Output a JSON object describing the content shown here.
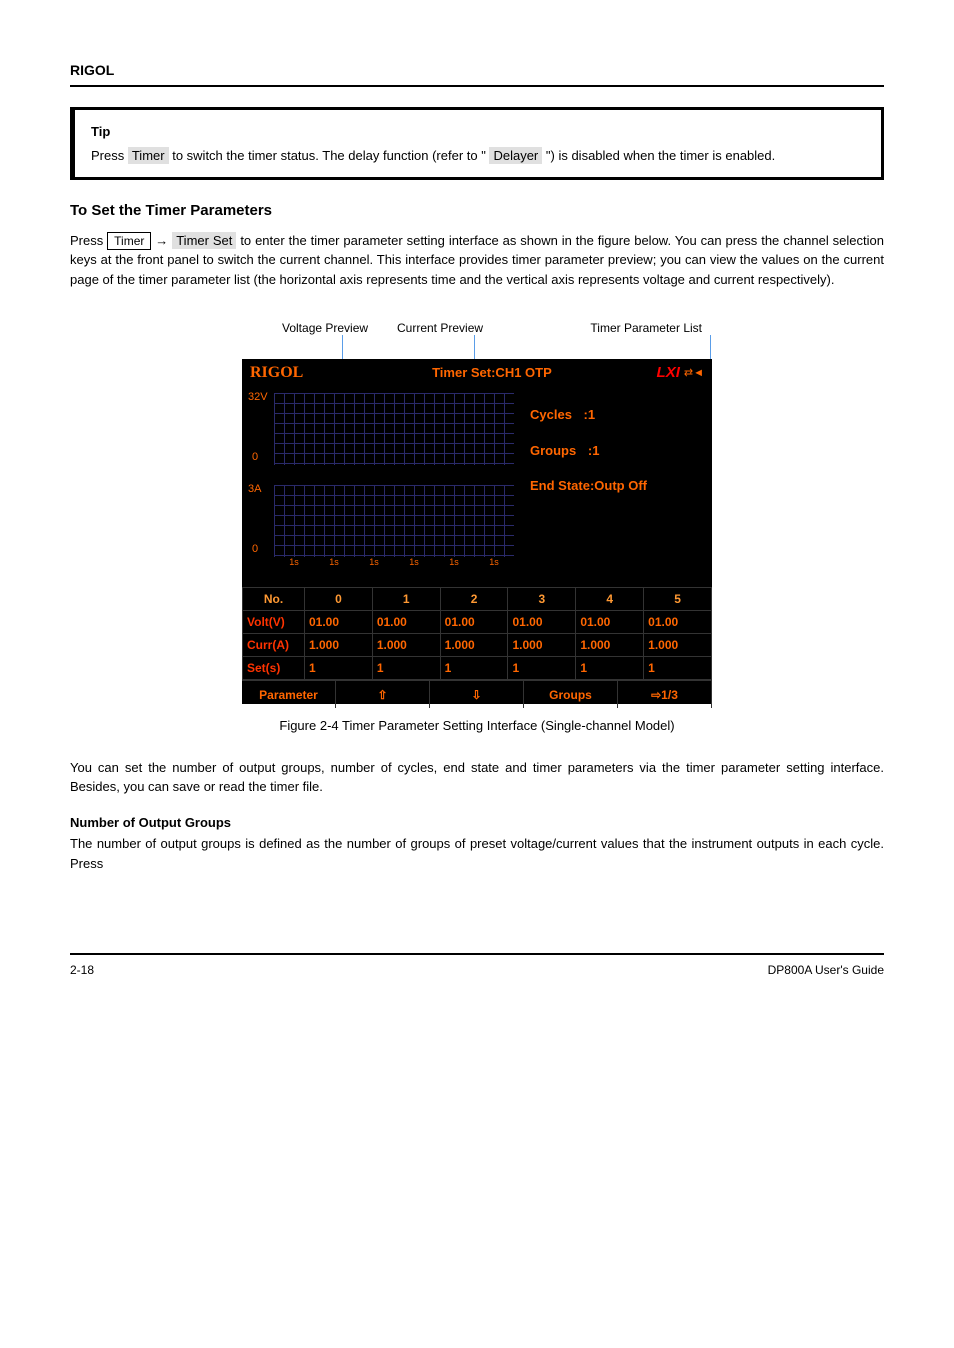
{
  "header": {
    "brand": "RIGOL"
  },
  "tip": {
    "title": "Tip",
    "text_before": "Press ",
    "btn1": "Timer",
    "text_mid": " to switch the timer status. The delay function (refer to \"",
    "btn2": "Delayer",
    "text_after": "\") is disabled when the timer is enabled."
  },
  "section": {
    "heading": "To Set the Timer Parameters",
    "para1_before": "Press ",
    "para1_btn1": "Timer",
    "para1_arrow": " → ",
    "para1_btn2": "Timer Set",
    "para1_after": " to enter the timer parameter setting interface as shown in the figure below. You can press the channel selection keys at the front panel to switch the current channel. This interface provides timer parameter preview; you can view the values on the current page of the timer parameter list (the horizontal axis represents time and the vertical axis represents voltage and current respectively).",
    "labels": {
      "volt": "Voltage Preview",
      "curr": "Current Preview",
      "list": "Timer Parameter List"
    }
  },
  "screen": {
    "logo": "RIGOL",
    "title": "Timer Set:CH1  OTP",
    "lxi": "LXI",
    "preview_volt_top": "32V",
    "preview_volt_bottom": "0",
    "preview_curr_top": "3A",
    "preview_curr_bottom": "0",
    "xticks": [
      "1s",
      "1s",
      "1s",
      "1s",
      "1s",
      "1s"
    ],
    "side": {
      "cycles_label": "Cycles",
      "cycles_val": ":1",
      "groups_label": "Groups",
      "groups_val": ":1",
      "endstate": "End State:Outp Off"
    },
    "table": {
      "headers": [
        "No.",
        "0",
        "1",
        "2",
        "3",
        "4",
        "5"
      ],
      "rows": [
        {
          "label": "Volt(V)",
          "cells": [
            "01.00",
            "01.00",
            "01.00",
            "01.00",
            "01.00",
            "01.00"
          ]
        },
        {
          "label": "Curr(A)",
          "cells": [
            "1.000",
            "1.000",
            "1.000",
            "1.000",
            "1.000",
            "1.000"
          ]
        },
        {
          "label": "Set(s)",
          "cells": [
            "1",
            "1",
            "1",
            "1",
            "1",
            "1"
          ]
        }
      ]
    },
    "menu": [
      "Parameter",
      "⇧",
      "⇩",
      "Groups",
      "⇨1/3"
    ]
  },
  "caption": "Figure 2-4 Timer Parameter Setting Interface (Single-channel Model)",
  "body": {
    "para2": "You can set the number of output groups, number of cycles, end state and timer parameters via the timer parameter setting interface. Besides, you can save or read the timer file.",
    "sub_heading": "Number of Output Groups",
    "para3": "The number of output groups is defined as the number of groups of preset voltage/current values that the instrument outputs in each cycle. Press"
  },
  "footer": {
    "page": "2-18",
    "manual": "DP800A User's Guide"
  },
  "chart_data": [
    {
      "type": "line",
      "title": "Voltage Preview",
      "xlabel": "time",
      "xticks": [
        "1s",
        "1s",
        "1s",
        "1s",
        "1s",
        "1s"
      ],
      "ylim": [
        0,
        32
      ],
      "yunit": "V",
      "series": [
        {
          "name": "Volt",
          "values": [
            1.0,
            1.0,
            1.0,
            1.0,
            1.0,
            1.0
          ]
        }
      ]
    },
    {
      "type": "line",
      "title": "Current Preview",
      "xlabel": "time",
      "xticks": [
        "1s",
        "1s",
        "1s",
        "1s",
        "1s",
        "1s"
      ],
      "ylim": [
        0,
        3
      ],
      "yunit": "A",
      "series": [
        {
          "name": "Curr",
          "values": [
            1.0,
            1.0,
            1.0,
            1.0,
            1.0,
            1.0
          ]
        }
      ]
    },
    {
      "type": "table",
      "title": "Timer Parameter List",
      "columns": [
        "No.",
        "0",
        "1",
        "2",
        "3",
        "4",
        "5"
      ],
      "rows": [
        [
          "Volt(V)",
          "01.00",
          "01.00",
          "01.00",
          "01.00",
          "01.00",
          "01.00"
        ],
        [
          "Curr(A)",
          "1.000",
          "1.000",
          "1.000",
          "1.000",
          "1.000",
          "1.000"
        ],
        [
          "Set(s)",
          "1",
          "1",
          "1",
          "1",
          "1",
          "1"
        ]
      ]
    }
  ]
}
